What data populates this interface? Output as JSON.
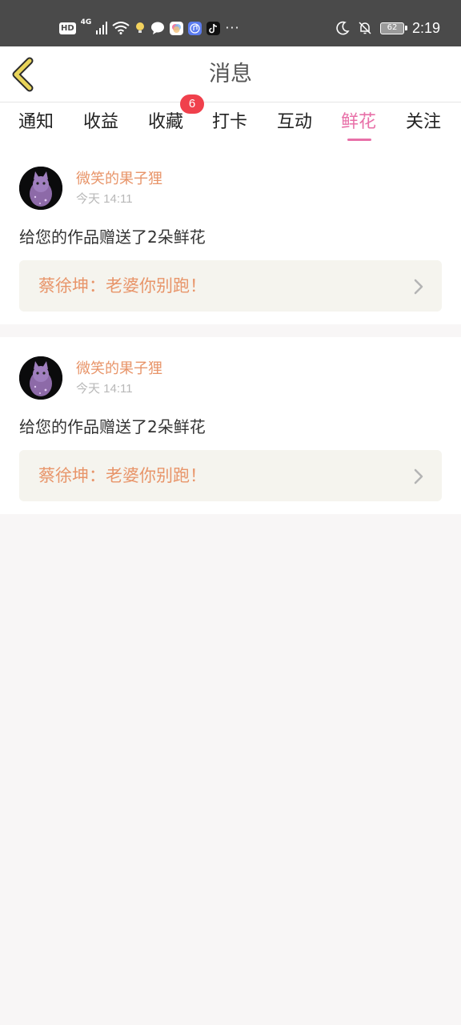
{
  "status_bar": {
    "hd": "HD",
    "network": "4G",
    "battery": "62",
    "time": "2:19",
    "more": "···",
    "icons": [
      "signal-icon",
      "wifi-icon",
      "bulb-icon",
      "chat-icon",
      "photos-icon",
      "music-icon",
      "tiktok-icon",
      "moon-icon",
      "bell-off-icon",
      "battery-icon"
    ]
  },
  "header": {
    "title": "消息",
    "back_icon": "chevron-left-icon"
  },
  "tabs": [
    {
      "label": "通知"
    },
    {
      "label": "收益"
    },
    {
      "label": "收藏",
      "badge": "6"
    },
    {
      "label": "打卡"
    },
    {
      "label": "互动"
    },
    {
      "label": "鲜花",
      "active": true
    },
    {
      "label": "关注"
    }
  ],
  "notifications": [
    {
      "sender": "微笑的果子狸",
      "time": "今天 14:11",
      "message": "给您的作品赠送了2朵鲜花",
      "work_title": "蔡徐坤：老婆你别跑！"
    },
    {
      "sender": "微笑的果子狸",
      "time": "今天 14:11",
      "message": "给您的作品赠送了2朵鲜花",
      "work_title": "蔡徐坤：老婆你别跑！"
    }
  ],
  "colors": {
    "accent": "#e870a8",
    "sender": "#e8956a",
    "badge": "#f0404c",
    "back_arrow": "#e8d45a"
  }
}
